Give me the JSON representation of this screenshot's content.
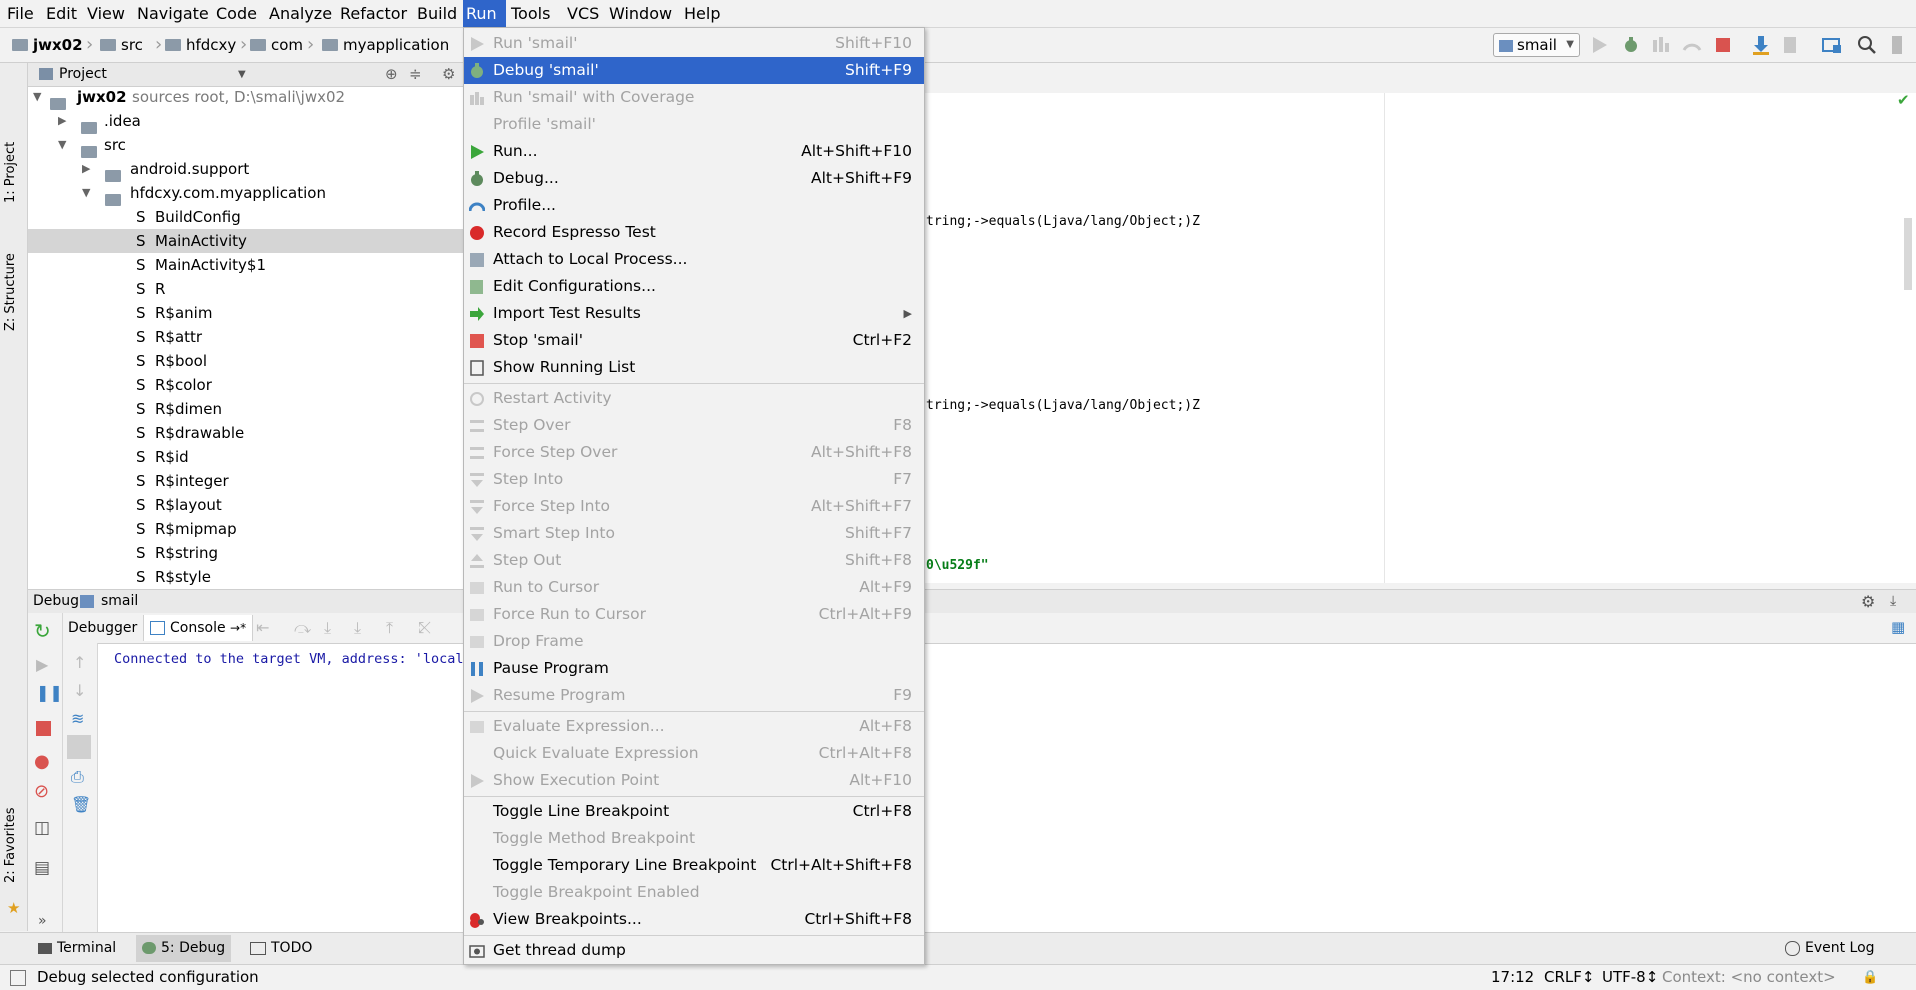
{
  "menubar": {
    "items": [
      "File",
      "Edit",
      "View",
      "Navigate",
      "Code",
      "Analyze",
      "Refactor",
      "Build",
      "Run",
      "Tools",
      "VCS",
      "Window",
      "Help"
    ]
  },
  "navbar": {
    "crumbs": [
      "jwx02",
      "src",
      "hfdcxy",
      "com",
      "myapplication"
    ],
    "run_config": "smail"
  },
  "leftstrip": {
    "project_tab": "1: Project",
    "structure_tab": "Z: Structure",
    "favorites_tab": "2: Favorites"
  },
  "project": {
    "header": "Project",
    "root_name": "jwx02",
    "root_meta": "sources root,  D:\\smali\\jwx02",
    "items": [
      {
        "label": ".idea"
      },
      {
        "label": "src"
      },
      {
        "label": "android.support"
      },
      {
        "label": "hfdcxy.com.myapplication"
      },
      {
        "label": "BuildConfig"
      },
      {
        "label": "MainActivity"
      },
      {
        "label": "MainActivity$1"
      },
      {
        "label": "R"
      },
      {
        "label": "R$anim"
      },
      {
        "label": "R$attr"
      },
      {
        "label": "R$bool"
      },
      {
        "label": "R$color"
      },
      {
        "label": "R$dimen"
      },
      {
        "label": "R$drawable"
      },
      {
        "label": "R$id"
      },
      {
        "label": "R$integer"
      },
      {
        "label": "R$layout"
      },
      {
        "label": "R$mipmap"
      },
      {
        "label": "R$string"
      },
      {
        "label": "R$style"
      }
    ],
    "file_prefix": "S"
  },
  "editor": {
    "lines": [
      "tring;->equals(Ljava/lang/Object;)Z",
      "tring;->equals(Ljava/lang/Object;)Z",
      "0\\u529f\""
    ]
  },
  "debug": {
    "header_label": "Debug",
    "config_name": "smail",
    "tab_debugger": "Debugger",
    "tab_console": "Console",
    "tab_console_suffix": "→*",
    "console_text": "Connected to the target VM, address: 'locall"
  },
  "tooltabs": {
    "terminal": "Terminal",
    "debug": "5: Debug",
    "todo": "TODO",
    "event_log": "Event Log"
  },
  "status": {
    "message": "Debug selected configuration",
    "position": "17:12",
    "line_sep": "CRLF↕",
    "encoding": "UTF-8↕",
    "context": "Context: <no context>"
  },
  "run_menu": {
    "items": [
      {
        "label": "Run 'smail'",
        "shortcut": "Shift+F10",
        "disabled": true
      },
      {
        "label": "Debug 'smail'",
        "shortcut": "Shift+F9",
        "disabled": false,
        "highlighted": true
      },
      {
        "label": "Run 'smail' with Coverage",
        "shortcut": "",
        "disabled": true
      },
      {
        "label": "Profile 'smail'",
        "shortcut": "",
        "disabled": true
      },
      {
        "label": "Run...",
        "shortcut": "Alt+Shift+F10",
        "disabled": false
      },
      {
        "label": "Debug...",
        "shortcut": "Alt+Shift+F9",
        "disabled": false
      },
      {
        "label": "Profile...",
        "shortcut": "",
        "disabled": false
      },
      {
        "label": "Record Espresso Test",
        "shortcut": "",
        "disabled": false
      },
      {
        "label": "Attach to Local Process...",
        "shortcut": "",
        "disabled": false
      },
      {
        "label": "Edit Configurations...",
        "shortcut": "",
        "disabled": false
      },
      {
        "label": "Import Test Results",
        "shortcut": "",
        "disabled": false,
        "submenu": true
      },
      {
        "label": "Stop 'smail'",
        "shortcut": "Ctrl+F2",
        "disabled": false
      },
      {
        "label": "Show Running List",
        "shortcut": "",
        "disabled": false
      },
      {
        "label": "Restart Activity",
        "shortcut": "",
        "disabled": true
      },
      {
        "label": "Step Over",
        "shortcut": "F8",
        "disabled": true
      },
      {
        "label": "Force Step Over",
        "shortcut": "Alt+Shift+F8",
        "disabled": true
      },
      {
        "label": "Step Into",
        "shortcut": "F7",
        "disabled": true
      },
      {
        "label": "Force Step Into",
        "shortcut": "Alt+Shift+F7",
        "disabled": true
      },
      {
        "label": "Smart Step Into",
        "shortcut": "Shift+F7",
        "disabled": true
      },
      {
        "label": "Step Out",
        "shortcut": "Shift+F8",
        "disabled": true
      },
      {
        "label": "Run to Cursor",
        "shortcut": "Alt+F9",
        "disabled": true
      },
      {
        "label": "Force Run to Cursor",
        "shortcut": "Ctrl+Alt+F9",
        "disabled": true
      },
      {
        "label": "Drop Frame",
        "shortcut": "",
        "disabled": true
      },
      {
        "label": "Pause Program",
        "shortcut": "",
        "disabled": false
      },
      {
        "label": "Resume Program",
        "shortcut": "F9",
        "disabled": true
      },
      {
        "label": "Evaluate Expression...",
        "shortcut": "Alt+F8",
        "disabled": true
      },
      {
        "label": "Quick Evaluate Expression",
        "shortcut": "Ctrl+Alt+F8",
        "disabled": true
      },
      {
        "label": "Show Execution Point",
        "shortcut": "Alt+F10",
        "disabled": true
      },
      {
        "label": "Toggle Line Breakpoint",
        "shortcut": "Ctrl+F8",
        "disabled": false
      },
      {
        "label": "Toggle Method Breakpoint",
        "shortcut": "",
        "disabled": true
      },
      {
        "label": "Toggle Temporary Line Breakpoint",
        "shortcut": "Ctrl+Alt+Shift+F8",
        "disabled": false
      },
      {
        "label": "Toggle Breakpoint Enabled",
        "shortcut": "",
        "disabled": true
      },
      {
        "label": "View Breakpoints...",
        "shortcut": "Ctrl+Shift+F8",
        "disabled": false
      },
      {
        "label": "Get thread dump",
        "shortcut": "",
        "disabled": false
      }
    ]
  },
  "colors": {
    "highlight": "#2f65ca",
    "run_green": "#3ba63b",
    "stop_red": "#d9534f",
    "disabled_text": "#a3a3a3"
  }
}
